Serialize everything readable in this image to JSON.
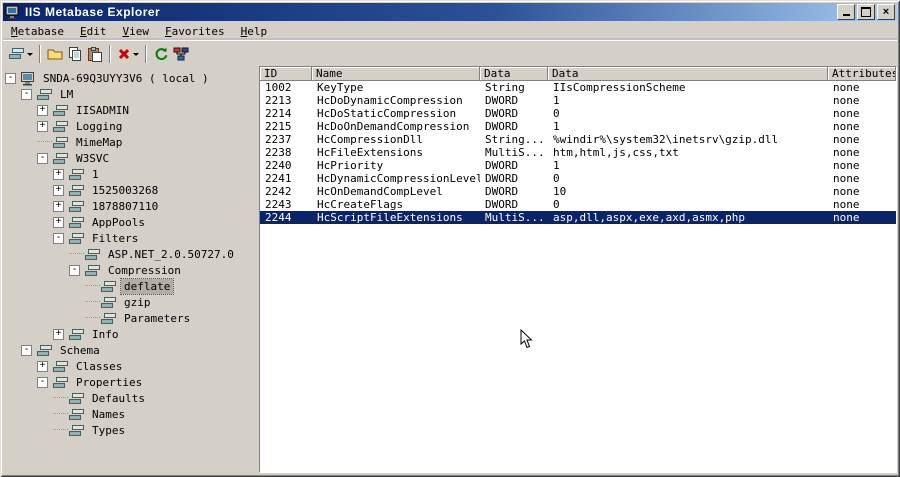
{
  "window": {
    "title": "IIS Metabase Explorer"
  },
  "menu": {
    "items": [
      {
        "label": "Metabase"
      },
      {
        "label": "Edit"
      },
      {
        "label": "View"
      },
      {
        "label": "Favorites"
      },
      {
        "label": "Help"
      }
    ]
  },
  "toolbar": {
    "buttons": [
      {
        "type": "button",
        "name": "new-key-button",
        "icon": "key-stack-icon",
        "dropdown": true
      },
      {
        "type": "sep"
      },
      {
        "type": "button",
        "name": "open-button",
        "icon": "folder-icon",
        "dropdown": false
      },
      {
        "type": "button",
        "name": "copy-button",
        "icon": "copy-icon",
        "dropdown": false
      },
      {
        "type": "button",
        "name": "paste-button",
        "icon": "paste-icon",
        "dropdown": false
      },
      {
        "type": "sep"
      },
      {
        "type": "button",
        "name": "delete-button",
        "icon": "delete-x-icon",
        "dropdown": true
      },
      {
        "type": "sep"
      },
      {
        "type": "button",
        "name": "refresh-button",
        "icon": "refresh-icon",
        "dropdown": false
      },
      {
        "type": "button",
        "name": "network-button",
        "icon": "network-icon",
        "dropdown": false
      }
    ]
  },
  "tree": {
    "items": [
      {
        "label": "SNDA-69Q3UYY3V6 ( local )",
        "depth": 0,
        "expand": "minus",
        "icon": "computer",
        "selected": false
      },
      {
        "label": "LM",
        "depth": 1,
        "expand": "minus",
        "icon": "key",
        "selected": false
      },
      {
        "label": "IISADMIN",
        "depth": 2,
        "expand": "plus",
        "icon": "key",
        "selected": false
      },
      {
        "label": "Logging",
        "depth": 2,
        "expand": "plus",
        "icon": "key",
        "selected": false
      },
      {
        "label": "MimeMap",
        "depth": 2,
        "expand": "none",
        "icon": "key",
        "selected": false
      },
      {
        "label": "W3SVC",
        "depth": 2,
        "expand": "minus",
        "icon": "key",
        "selected": false
      },
      {
        "label": "1",
        "depth": 3,
        "expand": "plus",
        "icon": "key",
        "selected": false
      },
      {
        "label": "1525003268",
        "depth": 3,
        "expand": "plus",
        "icon": "key",
        "selected": false
      },
      {
        "label": "1878807110",
        "depth": 3,
        "expand": "plus",
        "icon": "key",
        "selected": false
      },
      {
        "label": "AppPools",
        "depth": 3,
        "expand": "plus",
        "icon": "key",
        "selected": false
      },
      {
        "label": "Filters",
        "depth": 3,
        "expand": "minus",
        "icon": "key",
        "selected": false
      },
      {
        "label": "ASP.NET_2.0.50727.0",
        "depth": 4,
        "expand": "none",
        "icon": "key",
        "selected": false
      },
      {
        "label": "Compression",
        "depth": 4,
        "expand": "minus",
        "icon": "key",
        "selected": false
      },
      {
        "label": "deflate",
        "depth": 5,
        "expand": "none",
        "icon": "key",
        "selected": true
      },
      {
        "label": "gzip",
        "depth": 5,
        "expand": "none",
        "icon": "key",
        "selected": false
      },
      {
        "label": "Parameters",
        "depth": 5,
        "expand": "none",
        "icon": "key",
        "selected": false
      },
      {
        "label": "Info",
        "depth": 3,
        "expand": "plus",
        "icon": "key",
        "selected": false
      },
      {
        "label": "Schema",
        "depth": 1,
        "expand": "minus",
        "icon": "key",
        "selected": false
      },
      {
        "label": "Classes",
        "depth": 2,
        "expand": "plus",
        "icon": "key",
        "selected": false
      },
      {
        "label": "Properties",
        "depth": 2,
        "expand": "minus",
        "icon": "key",
        "selected": false
      },
      {
        "label": "Defaults",
        "depth": 3,
        "expand": "none",
        "icon": "key",
        "selected": false
      },
      {
        "label": "Names",
        "depth": 3,
        "expand": "none",
        "icon": "key",
        "selected": false
      },
      {
        "label": "Types",
        "depth": 3,
        "expand": "none",
        "icon": "key",
        "selected": false
      }
    ]
  },
  "table": {
    "columns": [
      "ID",
      "Name",
      "Data Type",
      "Data",
      "Attributes"
    ],
    "selected_index": 10,
    "rows": [
      [
        "1002",
        "KeyType",
        "String",
        "IIsCompressionScheme",
        "none"
      ],
      [
        "2213",
        "HcDoDynamicCompression",
        "DWORD",
        "1",
        "none"
      ],
      [
        "2214",
        "HcDoStaticCompression",
        "DWORD",
        "0",
        "none"
      ],
      [
        "2215",
        "HcDoOnDemandCompression",
        "DWORD",
        "1",
        "none"
      ],
      [
        "2237",
        "HcCompressionDll",
        "String...",
        "%windir%\\system32\\inetsrv\\gzip.dll",
        "none"
      ],
      [
        "2238",
        "HcFileExtensions",
        "MultiS...",
        "htm,html,js,css,txt",
        "none"
      ],
      [
        "2240",
        "HcPriority",
        "DWORD",
        "1",
        "none"
      ],
      [
        "2241",
        "HcDynamicCompressionLevel",
        "DWORD",
        "0",
        "none"
      ],
      [
        "2242",
        "HcOnDemandCompLevel",
        "DWORD",
        "10",
        "none"
      ],
      [
        "2243",
        "HcCreateFlags",
        "DWORD",
        "0",
        "none"
      ],
      [
        "2244",
        "HcScriptFileExtensions",
        "MultiS...",
        "asp,dll,aspx,exe,axd,asmx,php",
        "none"
      ]
    ]
  },
  "colors": {
    "titlebar_start": "#0a246a",
    "titlebar_end": "#a6caf0",
    "selection": "#0a246a",
    "window_bg": "#d4d0c8",
    "tree_inactive_selection": "#b1aea3"
  }
}
